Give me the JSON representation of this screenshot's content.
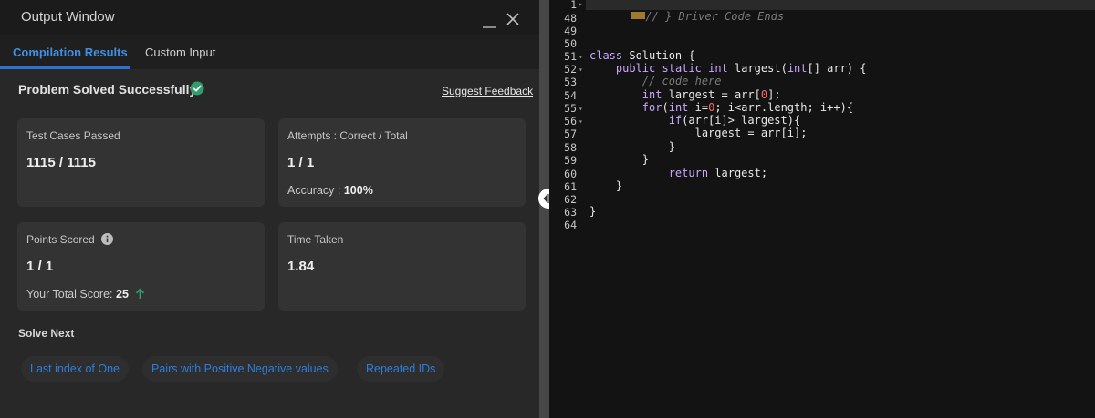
{
  "output_window": {
    "title": "Output Window",
    "tabs": [
      {
        "label": "Compilation Results",
        "active": true
      },
      {
        "label": "Custom Input",
        "active": false
      }
    ],
    "status": "Problem Solved Successfully",
    "feedback_link": "Suggest Feedback",
    "cards": {
      "test_cases": {
        "label": "Test Cases Passed",
        "value": "1115 / 1115"
      },
      "attempts": {
        "label": "Attempts : Correct / Total",
        "value": "1 / 1",
        "sub_label": "Accuracy :",
        "sub_value": "100%"
      },
      "points": {
        "label": "Points Scored",
        "value": "1 / 1",
        "sub_label": "Your Total Score:",
        "sub_value": "25"
      },
      "time": {
        "label": "Time Taken",
        "value": "1.84"
      }
    },
    "solve_next_heading": "Solve Next",
    "solve_next": [
      "Last index of One",
      "Pairs with Positive Negative values",
      "Repeated IDs"
    ]
  },
  "editor": {
    "line_numbers": [
      "1",
      "48",
      "49",
      "50",
      "51",
      "52",
      "53",
      "54",
      "55",
      "56",
      "57",
      "58",
      "59",
      "60",
      "61",
      "62",
      "63",
      "64"
    ],
    "first_line_comment": "// } Driver Code Ends",
    "code_lines": [
      "",
      "",
      "",
      "class Solution {",
      "    public static int largest(int[] arr) {",
      "        // code here",
      "        int largest = arr[0];",
      "        for(int i=0; i<arr.length; i++){",
      "            if(arr[i]> largest){",
      "                largest = arr[i];",
      "            }",
      "        }",
      "            return largest;",
      "    }",
      "",
      "}",
      ""
    ]
  },
  "colors": {
    "accent_blue": "#2f7ddb",
    "success_green": "#2e9e6b"
  }
}
